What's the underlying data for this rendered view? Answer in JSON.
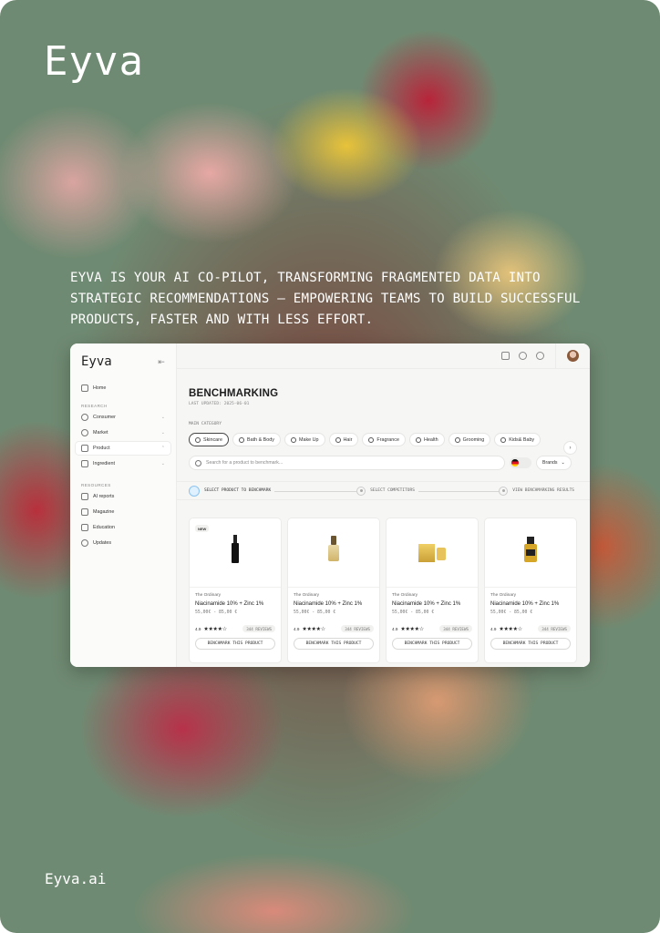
{
  "hero": {
    "logo": "Eyva",
    "tagline": "EYVA IS YOUR AI CO-PILOT, TRANSFORMING FRAGMENTED DATA INTO STRATEGIC RECOMMENDATIONS — EMPOWERING TEAMS TO BUILD SUCCESSFUL PRODUCTS, FASTER AND WITH LESS EFFORT.",
    "footer_url": "Eyva.ai"
  },
  "app": {
    "sidebar": {
      "logo": "Eyva",
      "home": "Home",
      "research_label": "RESEARCH",
      "research_items": [
        {
          "label": "Consumer",
          "icon": "user-icon"
        },
        {
          "label": "Market",
          "icon": "globe-icon"
        },
        {
          "label": "Product",
          "icon": "bag-icon"
        },
        {
          "label": "Ingredient",
          "icon": "cube-icon"
        }
      ],
      "resources_label": "RESOURCES",
      "resource_items": [
        {
          "label": "AI reports",
          "icon": "file-icon"
        },
        {
          "label": "Magazine",
          "icon": "book-icon"
        },
        {
          "label": "Education",
          "icon": "graduation-icon"
        },
        {
          "label": "Updates",
          "icon": "refresh-icon"
        }
      ]
    },
    "page": {
      "title": "BENCHMARKING",
      "last_updated": "LAST UPDATED: 2025-06-01",
      "category_label": "MAIN CATEGORY",
      "categories": [
        "Skincare",
        "Bath & Body",
        "Make Up",
        "Hair",
        "Fragrance",
        "Health",
        "Grooming",
        "Kids& Baby"
      ],
      "search_placeholder": "Search for a product to benchmark...",
      "brands_label": "Brands",
      "steps": [
        "SELECT PRODUCT TO BENCHMARK",
        "SELECT COMPETITORS",
        "VIEW BENCHMARKING RESULTS"
      ]
    },
    "products": [
      {
        "badge": "NEW",
        "brand": "The Ordinary",
        "name": "Niacinamide 10% + Zinc 1%",
        "price": "55,00€ - 85,00 €",
        "rating": "4.9",
        "stars": 4,
        "reviews": "344 REVIEWS",
        "button": "BENCHMARK THIS PRODUCT"
      },
      {
        "badge": "",
        "brand": "The Ordinary",
        "name": "Niacinamide 10% + Zinc 1%",
        "price": "55,00€ - 85,00 €",
        "rating": "4.9",
        "stars": 4,
        "reviews": "344 REVIEWS",
        "button": "BENCHMARK THIS PRODUCT"
      },
      {
        "badge": "",
        "brand": "The Ordinary",
        "name": "Niacinamide 10% + Zinc 1%",
        "price": "55,00€ - 85,00 €",
        "rating": "4.9",
        "stars": 4,
        "reviews": "344 REVIEWS",
        "button": "BENCHMARK THIS PRODUCT"
      },
      {
        "badge": "",
        "brand": "The Ordinary",
        "name": "Niacinamide 10% + Zinc 1%",
        "price": "55,00€ - 85,00 €",
        "rating": "4.9",
        "stars": 4,
        "reviews": "344 REVIEWS",
        "button": "BENCHMARK THIS PRODUCT"
      }
    ]
  }
}
